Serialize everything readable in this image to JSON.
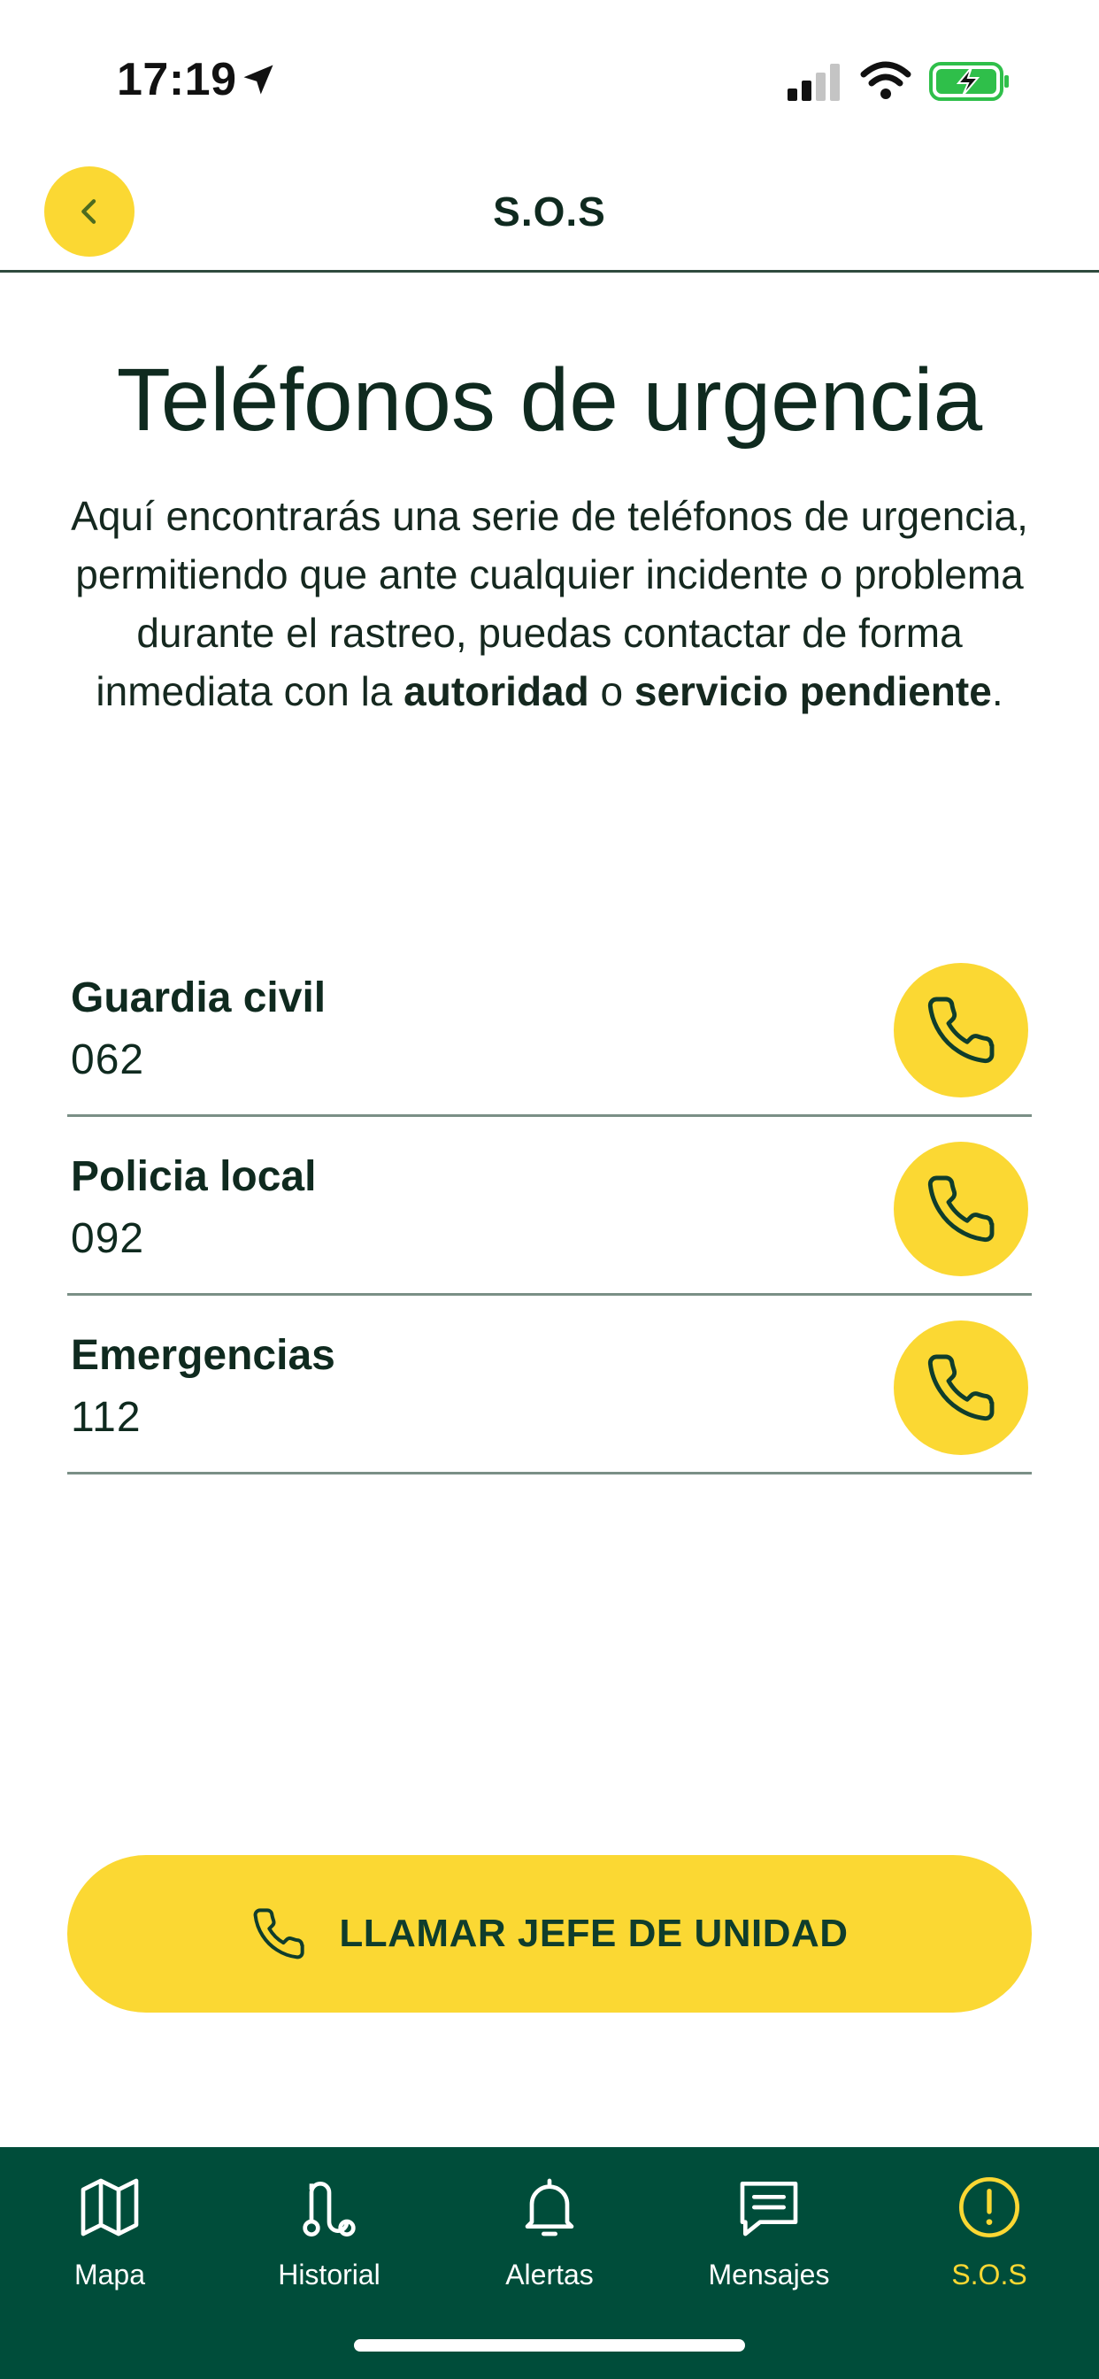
{
  "status_bar": {
    "time": "17:19"
  },
  "header": {
    "title": "S.O.S",
    "back_icon": "chevron-left-icon"
  },
  "intro": {
    "title": "Teléfonos de urgencia",
    "text_1": "Aquí encontrarás una serie de teléfonos de urgencia, permitiendo que ante cualquier incidente o problema durante el rastreo, puedas contactar de forma inmediata con la ",
    "bold_1": "autoridad",
    "text_2": " o ",
    "bold_2": "servicio pendiente",
    "text_3": "."
  },
  "contacts": [
    {
      "name": "Guardia civil",
      "number": "062",
      "icon": "phone-icon"
    },
    {
      "name": "Policia local",
      "number": "092",
      "icon": "phone-icon"
    },
    {
      "name": "Emergencias",
      "number": "112",
      "icon": "phone-icon"
    }
  ],
  "cta": {
    "label": "LLAMAR JEFE DE UNIDAD",
    "icon": "phone-icon"
  },
  "tabs": [
    {
      "label": "Mapa",
      "icon": "map-icon",
      "active": false
    },
    {
      "label": "Historial",
      "icon": "route-icon",
      "active": false
    },
    {
      "label": "Alertas",
      "icon": "bell-icon",
      "active": false
    },
    {
      "label": "Mensajes",
      "icon": "message-icon",
      "active": false
    },
    {
      "label": "S.O.S",
      "icon": "alert-circle-icon",
      "active": true
    }
  ],
  "colors": {
    "accent_yellow": "#fbd833",
    "dark_green": "#004d3a",
    "text_dark": "#0f2a1f"
  }
}
